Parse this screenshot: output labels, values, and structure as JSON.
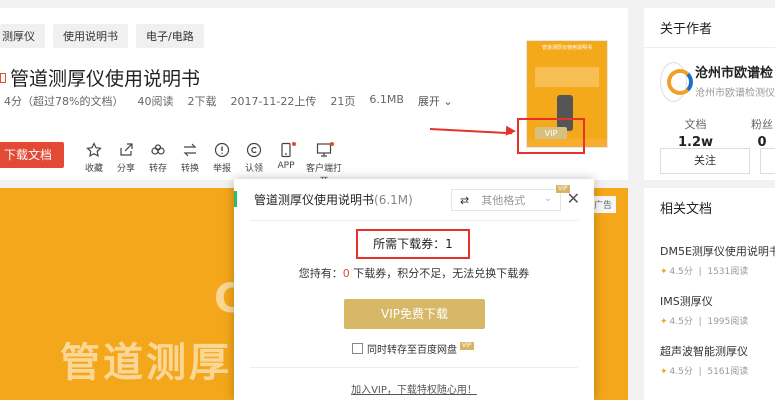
{
  "tags": [
    "测厚仪",
    "使用说明书",
    "电子/电路"
  ],
  "doc": {
    "title": "管道测厚仪使用说明书",
    "meta": {
      "score": "4分（超过78%的文档）",
      "reads": "40阅读",
      "downloads": "2下载",
      "uploaded": "2017-11-22上传",
      "pages": "21页",
      "size": "6.1MB",
      "expand": "展开"
    },
    "download_button": "下载文档",
    "tools": [
      "收藏",
      "分享",
      "转存",
      "转换",
      "举报",
      "认领",
      "APP",
      "客户端打开"
    ]
  },
  "thumbnail": {
    "head": "管道测厚仪使用说明书",
    "vip": "VIP"
  },
  "preview": {
    "ad": "广告",
    "big_letter": "C",
    "big_text": "管道测厚"
  },
  "author_panel": {
    "title": "关于作者",
    "name": "沧州市欧谱检",
    "subtitle": "沧州市欧谱检测仪",
    "docs_label": "文档",
    "docs_value": "1.2w",
    "fans_label": "粉丝",
    "fans_value": "0",
    "follow": "关注"
  },
  "related": {
    "title": "相关文档",
    "items": [
      {
        "name": "DM5E测厚仪使用说明书",
        "score": "4.5分",
        "reads": "1531阅读"
      },
      {
        "name": "IMS测厚仪",
        "score": "4.5分",
        "reads": "1995阅读"
      },
      {
        "name": "超声波智能测厚仪",
        "score": "4.5分",
        "reads": "5161阅读"
      }
    ]
  },
  "modal": {
    "title": "管道测厚仪使用说明书",
    "size": "(6.1M)",
    "format_placeholder": "其他格式",
    "vip_badge": "VIP",
    "need": "所需下载券：1",
    "hold_prefix": "您持有：",
    "hold_count": "0",
    "hold_suffix": "下载券，积分不足，无法兑换下载券",
    "vip_button": "VIP免费下载",
    "save_label": "同时转存至百度网盘",
    "save_vip_badge": "VIP",
    "join_link": "加入VIP，下载特权随心用！",
    "close": "✕"
  },
  "colors": {
    "accent_red": "#e24a36",
    "vip_gold": "#d7b868",
    "preview_orange": "#f4a71a"
  }
}
